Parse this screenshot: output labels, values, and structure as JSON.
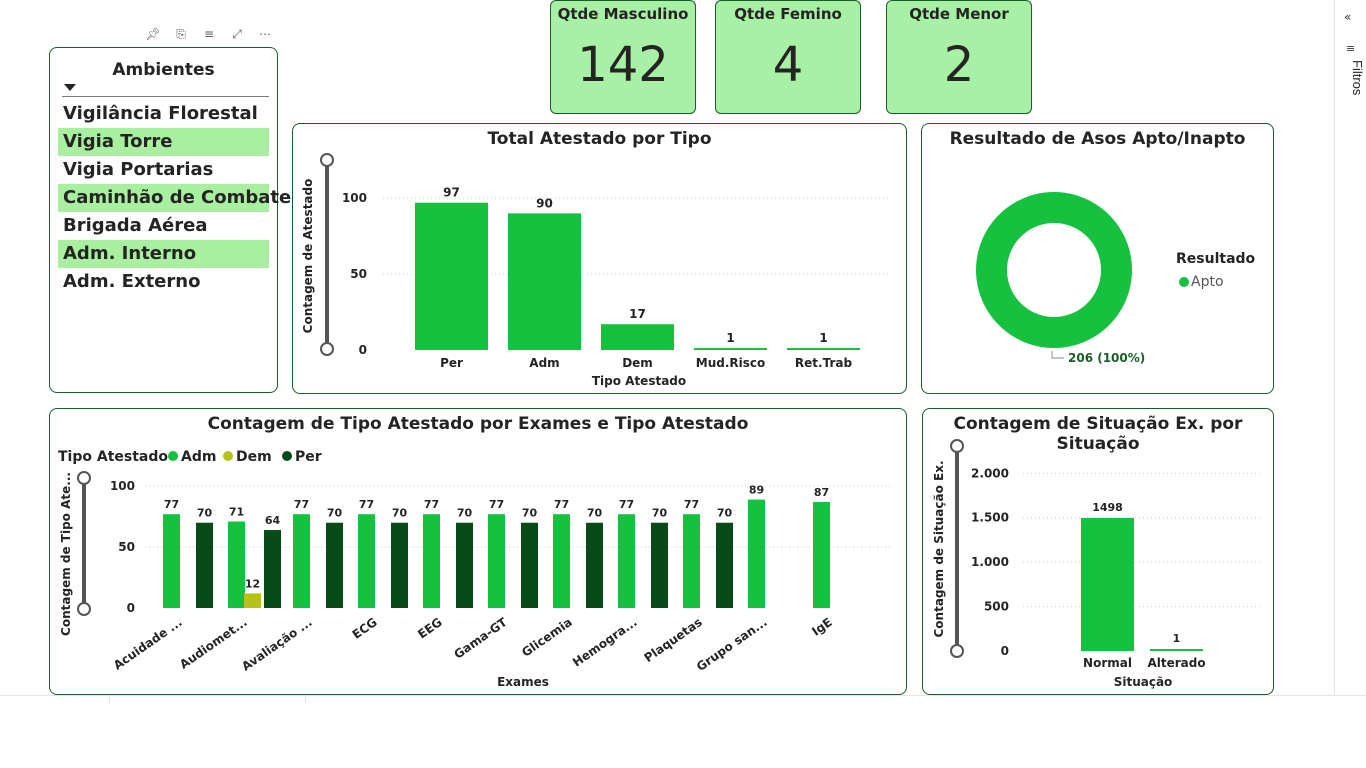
{
  "filters_panel": {
    "label": "Filtros",
    "collapse_icon": "chevron-double-left-icon",
    "filter_icon": "filter-icon"
  },
  "slicer": {
    "title": "Ambientes",
    "items": [
      {
        "label": "Vigilância Florestal",
        "selected": false
      },
      {
        "label": "Vigia Torre",
        "selected": true
      },
      {
        "label": "Vigia Portarias",
        "selected": false
      },
      {
        "label": "Caminhão de Combate",
        "selected": true
      },
      {
        "label": "Brigada Aérea",
        "selected": false
      },
      {
        "label": "Adm. Interno",
        "selected": true
      },
      {
        "label": "Adm. Externo",
        "selected": false
      }
    ]
  },
  "cards": [
    {
      "label": "Qtde Masculino",
      "value": "142"
    },
    {
      "label": "Qtde Femino",
      "value": "4"
    },
    {
      "label": "Qtde Menor",
      "value": "2"
    }
  ],
  "colors": {
    "bar_green": "#15c13f",
    "adm": "#15c13f",
    "dem": "#b5c21a",
    "per": "#084b19",
    "card_bg": "#a8f0a6",
    "border": "#1a5c2a"
  },
  "chart_data": [
    {
      "type": "bar",
      "title": "Total Atestado por Tipo",
      "xlabel": "Tipo Atestado",
      "ylabel": "Contagem de Atestado",
      "categories": [
        "Per",
        "Adm",
        "Dem",
        "Mud.Risco",
        "Ret.Trab"
      ],
      "values": [
        97,
        90,
        17,
        1,
        1
      ],
      "ylim": [
        0,
        110
      ],
      "yticks": [
        "100",
        "50",
        "0"
      ]
    },
    {
      "type": "pie",
      "title": "Resultado de Asos Apto/Inapto",
      "legend_title": "Resultado",
      "legend_placement": "right",
      "slices": [
        {
          "name": "Apto",
          "value": 206,
          "label": "206 (100%)"
        }
      ]
    },
    {
      "type": "bar",
      "title": "Contagem de Tipo Atestado por Exames e Tipo Atestado",
      "legend_title": "Tipo Atestado",
      "legend_placement": "top-left",
      "xlabel": "Exames",
      "ylabel": "Contagem de Tipo Ate...",
      "categories": [
        "Acuidade ...",
        "Audiomet...",
        "Avaliação ...",
        "ECG",
        "EEG",
        "Gama-GT",
        "Glicemia",
        "Hemogra...",
        "Plaquetas",
        "Grupo san...",
        "IgE"
      ],
      "series": [
        {
          "name": "Adm",
          "values": [
            77,
            71,
            77,
            77,
            77,
            77,
            77,
            77,
            77,
            89,
            87
          ]
        },
        {
          "name": "Dem",
          "values": [
            null,
            12,
            null,
            null,
            null,
            null,
            null,
            null,
            null,
            null,
            null
          ]
        },
        {
          "name": "Per",
          "values": [
            70,
            64,
            70,
            70,
            70,
            70,
            70,
            70,
            70,
            null,
            null
          ]
        }
      ],
      "ylim": [
        0,
        110
      ],
      "yticks": [
        "100",
        "50",
        "0"
      ]
    },
    {
      "type": "bar",
      "title": "Contagem de Situação Ex. por Situação",
      "xlabel": "Situação",
      "ylabel": "Contagem de Situação Ex.",
      "categories": [
        "Normal",
        "Alterado"
      ],
      "values": [
        1498,
        1
      ],
      "ylim": [
        0,
        2150
      ],
      "yticks": [
        "2.000",
        "1.500",
        "1.000",
        "500",
        "0"
      ]
    }
  ]
}
